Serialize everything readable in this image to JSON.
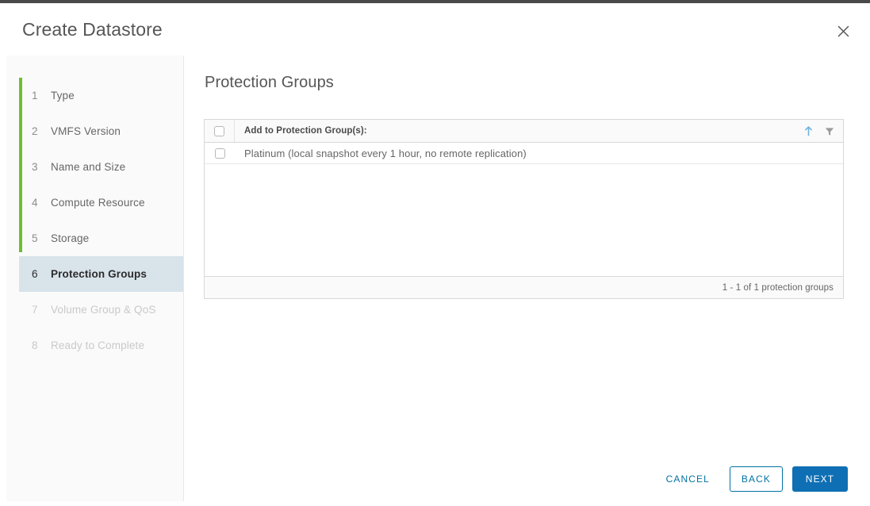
{
  "window": {
    "title": "Create Datastore",
    "close_label": "×",
    "close_icon": "close-icon"
  },
  "stepper": {
    "steps": [
      {
        "num": "1",
        "label": "Type",
        "state": "completed"
      },
      {
        "num": "2",
        "label": "VMFS Version",
        "state": "completed"
      },
      {
        "num": "3",
        "label": "Name and Size",
        "state": "completed"
      },
      {
        "num": "4",
        "label": "Compute Resource",
        "state": "completed"
      },
      {
        "num": "5",
        "label": "Storage",
        "state": "completed"
      },
      {
        "num": "6",
        "label": "Protection Groups",
        "state": "active"
      },
      {
        "num": "7",
        "label": "Volume Group & QoS",
        "state": "disabled"
      },
      {
        "num": "8",
        "label": "Ready to Complete",
        "state": "disabled"
      }
    ],
    "rail_color": "#6cbf2e",
    "active_bg": "#d8e3ea"
  },
  "content": {
    "title": "Protection Groups",
    "grid": {
      "column_header": "Add to Protection Group(s):",
      "select_all_checked": false,
      "sort_icon": "sort-ascending-icon",
      "filter_icon": "filter-icon",
      "sort_active_color": "#6eb4dc",
      "rows": [
        {
          "label": "Platinum (local snapshot every 1 hour, no remote replication)",
          "checked": false
        }
      ],
      "footer_text": "1 - 1 of 1 protection groups"
    }
  },
  "footer": {
    "cancel_label": "Cancel",
    "back_label": "Back",
    "next_label": "Next",
    "primary_color": "#0f6fb4",
    "link_color": "#0072a3"
  }
}
